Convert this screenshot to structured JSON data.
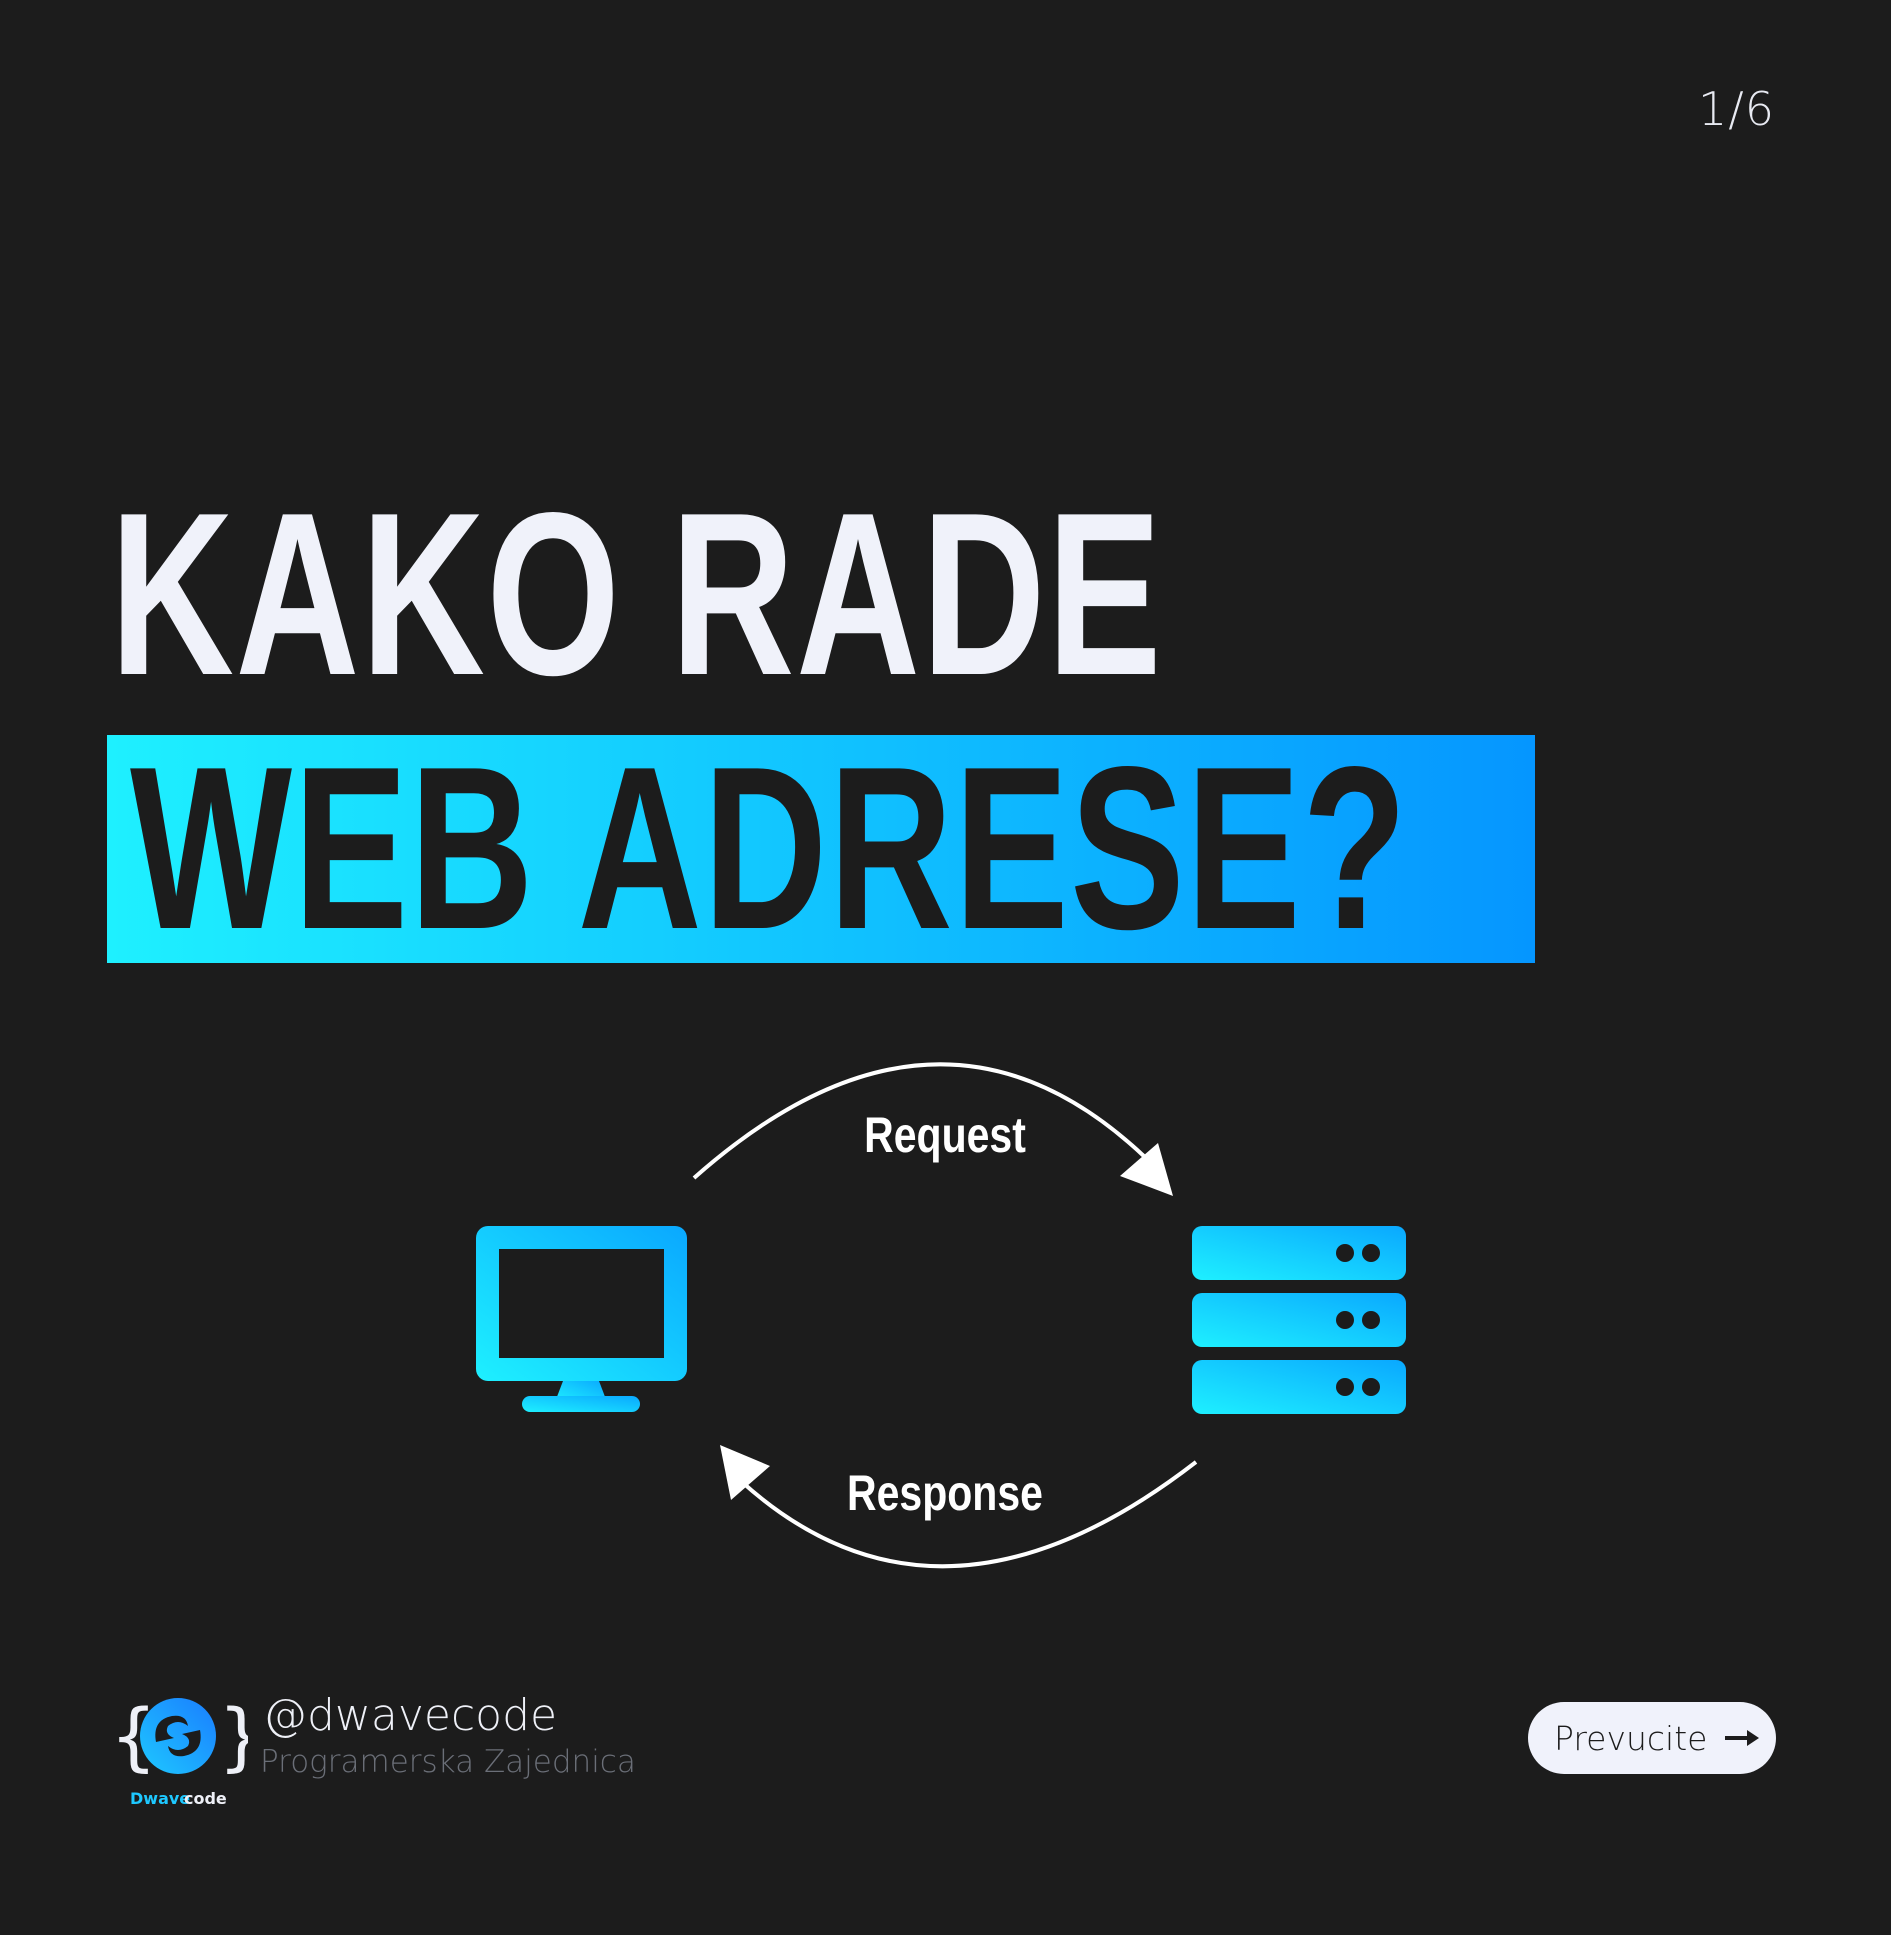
{
  "page_counter": "1/6",
  "title": {
    "line1": "KAKO RADE",
    "line2": "WEB ADRESE?"
  },
  "diagram": {
    "request_label": "Request",
    "response_label": "Response",
    "client_icon": "monitor-icon",
    "server_icon": "server-stack-icon"
  },
  "brand": {
    "logo_text": "Dwavecode",
    "logo_text_part1": "Dwave",
    "logo_text_part2": "code",
    "handle": "@dwavecode",
    "tagline": "Programerska Zajednica"
  },
  "swipe_button": {
    "label": "Prevucite",
    "icon": "arrow-right-icon"
  },
  "colors": {
    "background": "#1c1c1c",
    "accent_start": "#1ef0ff",
    "accent_end": "#0596ff",
    "text": "#f0f2fa",
    "muted": "#6b6f78"
  }
}
